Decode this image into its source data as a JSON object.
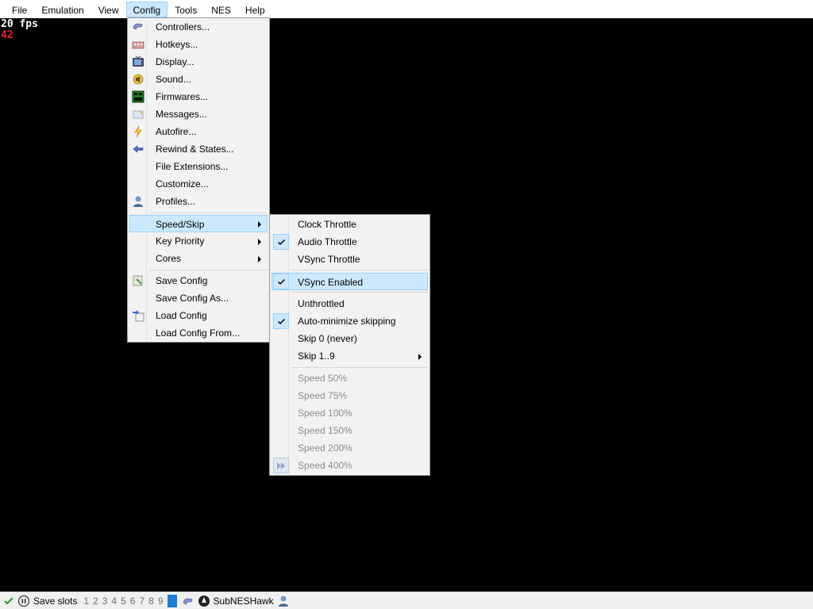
{
  "menubar": {
    "items": [
      "File",
      "Emulation",
      "View",
      "Config",
      "Tools",
      "NES",
      "Help"
    ]
  },
  "overlay": {
    "fps": "20 fps",
    "lag": "42"
  },
  "config_menu": {
    "items": [
      {
        "label": "Controllers...",
        "icon": "gamepad-icon"
      },
      {
        "label": "Hotkeys...",
        "icon": "keyboard-icon"
      },
      {
        "label": "Display...",
        "icon": "tv-icon"
      },
      {
        "label": "Sound...",
        "icon": "speaker-icon"
      },
      {
        "label": "Firmwares...",
        "icon": "chip-icon"
      },
      {
        "label": "Messages...",
        "icon": "message-icon"
      },
      {
        "label": "Autofire...",
        "icon": "lightning-icon"
      },
      {
        "label": "Rewind & States...",
        "icon": "rewind-arrow-icon"
      },
      {
        "label": "File Extensions..."
      },
      {
        "label": "Customize..."
      },
      {
        "label": "Profiles...",
        "icon": "user-icon"
      },
      {
        "label": "Speed/Skip",
        "submenu": true
      },
      {
        "label": "Key Priority",
        "submenu": true
      },
      {
        "label": "Cores",
        "submenu": true
      },
      {
        "label": "Save Config",
        "icon": "save-config-icon"
      },
      {
        "label": "Save Config As..."
      },
      {
        "label": "Load Config",
        "icon": "load-config-icon"
      },
      {
        "label": "Load Config From..."
      }
    ]
  },
  "speed_menu": {
    "items": [
      {
        "label": "Clock Throttle",
        "checked": false
      },
      {
        "label": "Audio Throttle",
        "checked": true
      },
      {
        "label": "VSync Throttle",
        "checked": false
      },
      {
        "label": "VSync Enabled",
        "checked": true
      },
      {
        "label": "Unthrottled",
        "checked": false
      },
      {
        "label": "Auto-minimize skipping",
        "checked": true
      },
      {
        "label": "Skip 0 (never)",
        "checked": false
      },
      {
        "label": "Skip 1..9",
        "submenu": true
      },
      {
        "label": "Speed 50%",
        "disabled": true
      },
      {
        "label": "Speed 75%",
        "disabled": true
      },
      {
        "label": "Speed 100%",
        "disabled": true
      },
      {
        "label": "Speed 150%",
        "disabled": true
      },
      {
        "label": "Speed 200%",
        "disabled": true
      },
      {
        "label": "Speed 400%",
        "disabled": true,
        "icon": "fast-forward-icon"
      }
    ]
  },
  "statusbar": {
    "save_slots_label": "Save slots",
    "slots": [
      "1",
      "2",
      "3",
      "4",
      "5",
      "6",
      "7",
      "8",
      "9"
    ],
    "core_name": "SubNESHawk"
  },
  "colors": {
    "highlight": "#cce8ff",
    "highlight_border": "#99d1ff",
    "lag_counter": "#e0202a",
    "active_slot": "#1e7cd6"
  }
}
